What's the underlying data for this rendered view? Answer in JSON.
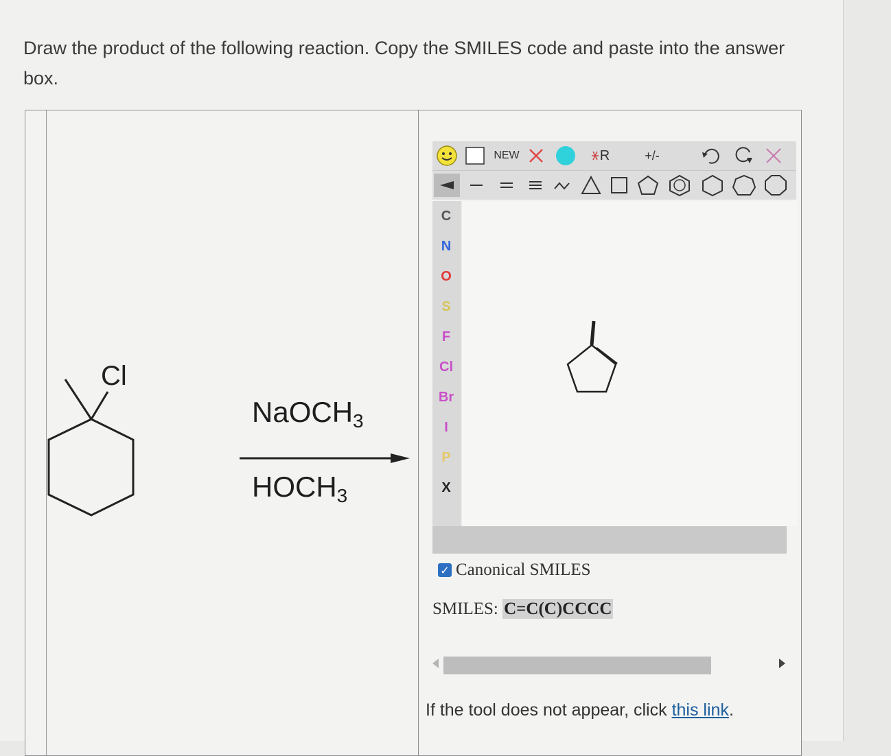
{
  "question": {
    "text": "Draw the product of the following reaction. Copy the SMILES code and paste into the answer box."
  },
  "reaction": {
    "reactant_label": "Cl",
    "reagent_top": "NaOCH",
    "reagent_top_sub": "3",
    "reagent_bottom": "HOCH",
    "reagent_bottom_sub": "3"
  },
  "editor": {
    "toolbar": {
      "new_label": "NEW",
      "rgroup_label": "R",
      "charge_label": "+/-"
    },
    "atoms": [
      {
        "symbol": "C",
        "color": "#555555"
      },
      {
        "symbol": "N",
        "color": "#3366dd"
      },
      {
        "symbol": "O",
        "color": "#e03a3a"
      },
      {
        "symbol": "S",
        "color": "#d6c55a"
      },
      {
        "symbol": "F",
        "color": "#c94fc9"
      },
      {
        "symbol": "Cl",
        "color": "#c94fc9"
      },
      {
        "symbol": "Br",
        "color": "#c94fc9"
      },
      {
        "symbol": "I",
        "color": "#c94fc9"
      },
      {
        "symbol": "P",
        "color": "#e6c86a"
      },
      {
        "symbol": "X",
        "color": "#222222"
      }
    ],
    "canonical_label": "Canonical SMILES",
    "smiles_label": "SMILES: ",
    "smiles_value": "C=C(C)CCCC"
  },
  "footer": {
    "text_before": "If the tool does not appear, click ",
    "link_text": "this link",
    "text_after": "."
  }
}
